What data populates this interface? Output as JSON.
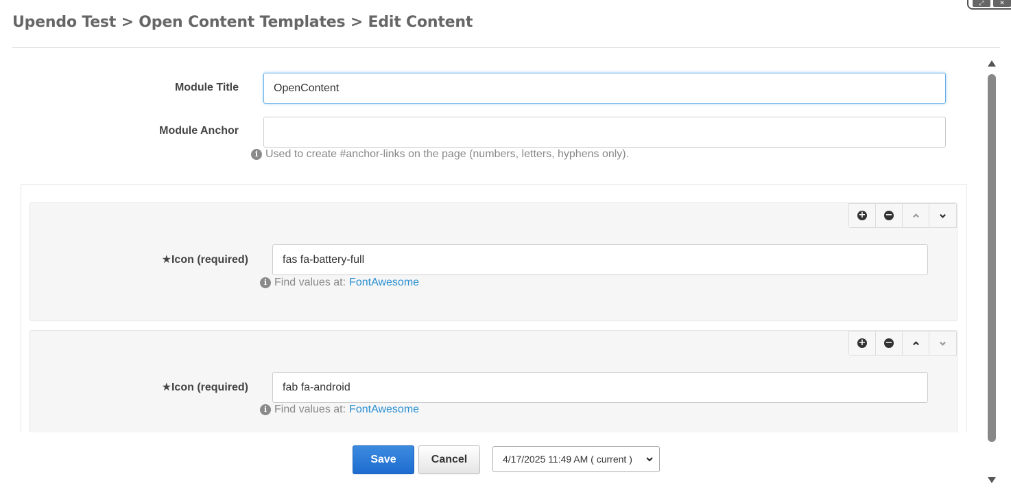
{
  "breadcrumb": "Upendo Test > Open Content Templates > Edit Content",
  "module_title": {
    "label": "Module Title",
    "value": "OpenContent"
  },
  "module_anchor": {
    "label": "Module Anchor",
    "value": "",
    "help": "Used to create #anchor-links on the page (numbers, letters, hyphens only)."
  },
  "items": [
    {
      "label": "Icon (required)",
      "required_mark": "★",
      "value": "fas fa-battery-full",
      "help_prefix": "Find values at:",
      "help_link": "FontAwesome"
    },
    {
      "label": "Icon (required)",
      "required_mark": "★",
      "value": "fab fa-android",
      "help_prefix": "Find values at:",
      "help_link": "FontAwesome"
    }
  ],
  "toolbar_icons": [
    "plus-circle-icon",
    "minus-circle-icon",
    "chevron-up-icon",
    "chevron-down-icon"
  ],
  "actions": {
    "save_label": "Save",
    "cancel_label": "Cancel",
    "version_value": "4/17/2025 11:49 AM ( current )"
  },
  "colors": {
    "primary_button": "#1e6ccf",
    "link": "#2a8fd0",
    "focus_border": "#66afe9"
  }
}
